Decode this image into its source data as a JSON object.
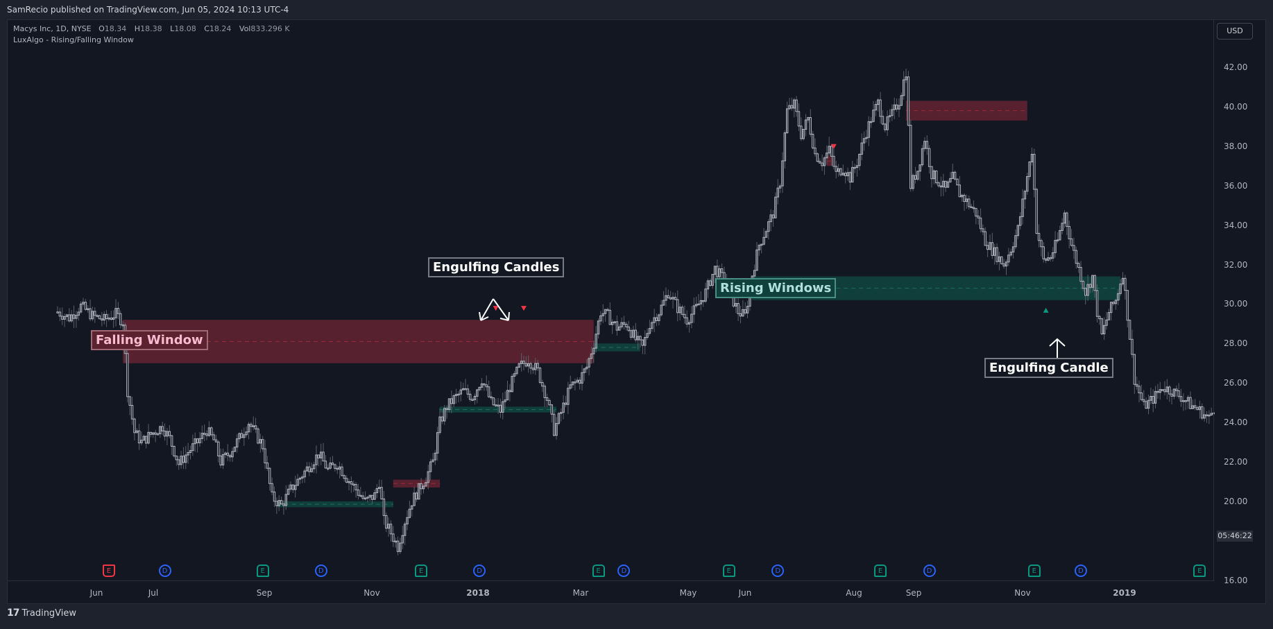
{
  "header": {
    "published": "SamRecio published on TradingView.com, Jun 05, 2024 10:13 UTC-4"
  },
  "legend": {
    "symbol": "Macys Inc, 1D, NYSE",
    "open_label": "O",
    "open": "18.34",
    "high_label": "H",
    "high": "18.38",
    "low_label": "L",
    "low": "18.08",
    "close_label": "C",
    "close": "18.24",
    "vol_label": "Vol",
    "vol": "833.296 K",
    "indicator": "LuxAlgo - Rising/Falling Window"
  },
  "currency": "USD",
  "countdown": "05:46:22",
  "footer": {
    "brand": "TradingView",
    "logo": "17"
  },
  "annotations": {
    "falling": "Falling Window",
    "rising": "Rising Windows",
    "engulfing_plural": "Engulfing Candles",
    "engulfing_single": "Engulfing Candle"
  },
  "colors": {
    "bg": "#131722",
    "candle": "#b2b5be",
    "bear_window": "#5c2230",
    "bull_window": "#10403c",
    "red": "#f23645",
    "green": "#089981",
    "blue": "#2962ff"
  },
  "chart_data": {
    "type": "candlestick",
    "title": "Macys Inc, 1D, NYSE",
    "ylim": [
      15.6,
      42.9
    ],
    "y_ticks": [
      "42.00",
      "40.00",
      "38.00",
      "36.00",
      "34.00",
      "32.00",
      "30.00",
      "28.00",
      "26.00",
      "24.00",
      "22.00",
      "20.00",
      "16.00"
    ],
    "x_ticks": [
      "Jun",
      "Jul",
      "Sep",
      "Nov",
      "2018",
      "Mar",
      "May",
      "Jun",
      "Aug",
      "Sep",
      "Nov",
      "2019"
    ],
    "price_path": [
      [
        0,
        29.6
      ],
      [
        5,
        29.3
      ],
      [
        10,
        29.9
      ],
      [
        15,
        29.4
      ],
      [
        20,
        29.2
      ],
      [
        25,
        29.5
      ],
      [
        28,
        29.1
      ],
      [
        30,
        25.6
      ],
      [
        33,
        23.5
      ],
      [
        36,
        23.0
      ],
      [
        40,
        23.4
      ],
      [
        45,
        23.8
      ],
      [
        48,
        23.2
      ],
      [
        52,
        21.9
      ],
      [
        56,
        22.5
      ],
      [
        60,
        23.0
      ],
      [
        64,
        23.6
      ],
      [
        67,
        23.1
      ],
      [
        70,
        22.0
      ],
      [
        74,
        22.5
      ],
      [
        78,
        23.2
      ],
      [
        82,
        24.0
      ],
      [
        85,
        23.4
      ],
      [
        88,
        22.8
      ],
      [
        92,
        20.2
      ],
      [
        96,
        19.8
      ],
      [
        100,
        20.6
      ],
      [
        104,
        21.2
      ],
      [
        108,
        21.8
      ],
      [
        112,
        22.4
      ],
      [
        116,
        21.6
      ],
      [
        120,
        21.9
      ],
      [
        124,
        21.2
      ],
      [
        128,
        20.6
      ],
      [
        132,
        20.0
      ],
      [
        136,
        20.3
      ],
      [
        138,
        21.0
      ],
      [
        140,
        19.0
      ],
      [
        143,
        18.4
      ],
      [
        146,
        17.7
      ],
      [
        149,
        19.0
      ],
      [
        152,
        20.0
      ],
      [
        155,
        20.6
      ],
      [
        158,
        21.2
      ],
      [
        161,
        22.0
      ],
      [
        164,
        24.0
      ],
      [
        167,
        24.8
      ],
      [
        170,
        25.2
      ],
      [
        174,
        25.6
      ],
      [
        178,
        25.3
      ],
      [
        182,
        26.2
      ],
      [
        186,
        25.0
      ],
      [
        190,
        24.6
      ],
      [
        194,
        25.8
      ],
      [
        198,
        26.8
      ],
      [
        202,
        27.2
      ],
      [
        206,
        26.6
      ],
      [
        210,
        25.2
      ],
      [
        213,
        23.6
      ],
      [
        216,
        24.5
      ],
      [
        220,
        25.8
      ],
      [
        224,
        26.2
      ],
      [
        227,
        26.8
      ],
      [
        230,
        28.0
      ],
      [
        233,
        29.6
      ],
      [
        236,
        29.4
      ],
      [
        240,
        28.8
      ],
      [
        244,
        29.0
      ],
      [
        248,
        28.2
      ],
      [
        251,
        27.8
      ],
      [
        254,
        29.0
      ],
      [
        258,
        29.6
      ],
      [
        262,
        30.6
      ],
      [
        266,
        29.8
      ],
      [
        270,
        29.2
      ],
      [
        274,
        29.8
      ],
      [
        278,
        30.6
      ],
      [
        282,
        31.8
      ],
      [
        286,
        31.2
      ],
      [
        289,
        30.4
      ],
      [
        292,
        29.6
      ],
      [
        295,
        29.4
      ],
      [
        298,
        31.5
      ],
      [
        301,
        33.0
      ],
      [
        304,
        33.8
      ],
      [
        307,
        34.6
      ],
      [
        310,
        36.2
      ],
      [
        313,
        39.8
      ],
      [
        316,
        40.1
      ],
      [
        319,
        38.6
      ],
      [
        322,
        39.4
      ],
      [
        325,
        37.6
      ],
      [
        328,
        37.2
      ],
      [
        331,
        37.8
      ],
      [
        334,
        36.6
      ],
      [
        337,
        36.9
      ],
      [
        340,
        36.4
      ],
      [
        343,
        37.2
      ],
      [
        346,
        38.4
      ],
      [
        349,
        39.4
      ],
      [
        352,
        40.2
      ],
      [
        355,
        39.0
      ],
      [
        358,
        39.6
      ],
      [
        361,
        40.3
      ],
      [
        364,
        41.8
      ],
      [
        366,
        36.0
      ],
      [
        369,
        36.8
      ],
      [
        372,
        38.4
      ],
      [
        375,
        36.6
      ],
      [
        378,
        36.2
      ],
      [
        381,
        35.8
      ],
      [
        384,
        36.4
      ],
      [
        387,
        35.6
      ],
      [
        390,
        35.2
      ],
      [
        394,
        34.6
      ],
      [
        398,
        33.2
      ],
      [
        402,
        32.6
      ],
      [
        406,
        32.0
      ],
      [
        409,
        32.8
      ],
      [
        412,
        33.8
      ],
      [
        415,
        35.8
      ],
      [
        418,
        37.8
      ],
      [
        420,
        33.8
      ],
      [
        423,
        32.2
      ],
      [
        426,
        32.4
      ],
      [
        429,
        33.2
      ],
      [
        432,
        34.6
      ],
      [
        435,
        33.0
      ],
      [
        438,
        31.8
      ],
      [
        441,
        30.6
      ],
      [
        444,
        31.4
      ],
      [
        446,
        29.6
      ],
      [
        448,
        28.4
      ],
      [
        451,
        29.6
      ],
      [
        454,
        30.2
      ],
      [
        457,
        31.6
      ],
      [
        462,
        26.2
      ],
      [
        466,
        24.8
      ],
      [
        470,
        25.2
      ],
      [
        474,
        25.8
      ],
      [
        478,
        25.6
      ],
      [
        482,
        25.3
      ],
      [
        486,
        24.9
      ],
      [
        490,
        24.6
      ],
      [
        494,
        24.2
      ],
      [
        497,
        25.0
      ]
    ],
    "windows": [
      {
        "kind": "falling",
        "top": 29.2,
        "bottom": 27.0,
        "from": 28,
        "to": 230
      },
      {
        "kind": "rising",
        "top": 28.0,
        "bottom": 27.6,
        "from": 230,
        "to": 250
      },
      {
        "kind": "rising",
        "top": 24.8,
        "bottom": 24.5,
        "from": 164,
        "to": 214
      },
      {
        "kind": "rising",
        "top": 20.0,
        "bottom": 19.7,
        "from": 94,
        "to": 144
      },
      {
        "kind": "falling",
        "top": 21.1,
        "bottom": 20.7,
        "from": 144,
        "to": 164
      },
      {
        "kind": "rising",
        "top": 31.4,
        "bottom": 30.2,
        "from": 298,
        "to": 456
      },
      {
        "kind": "falling",
        "top": 40.3,
        "bottom": 39.3,
        "from": 364,
        "to": 416
      },
      {
        "kind": "falling",
        "top": 37.5,
        "bottom": 37.0,
        "from": 330,
        "to": 333
      }
    ],
    "signals": [
      {
        "kind": "bear",
        "bar": 188,
        "price": 29.8
      },
      {
        "kind": "bear",
        "bar": 200,
        "price": 29.8
      },
      {
        "kind": "bear",
        "bar": 333,
        "price": 38.0
      },
      {
        "kind": "bull",
        "bar": 424,
        "price": 29.7
      }
    ],
    "events": [
      {
        "kind": "er",
        "label": "E",
        "bar": 22
      },
      {
        "kind": "d",
        "label": "D",
        "bar": 46
      },
      {
        "kind": "e",
        "label": "E",
        "bar": 88
      },
      {
        "kind": "d",
        "label": "D",
        "bar": 113
      },
      {
        "kind": "e",
        "label": "E",
        "bar": 156
      },
      {
        "kind": "d",
        "label": "D",
        "bar": 181
      },
      {
        "kind": "e",
        "label": "E",
        "bar": 232
      },
      {
        "kind": "d",
        "label": "D",
        "bar": 243
      },
      {
        "kind": "e",
        "label": "E",
        "bar": 288
      },
      {
        "kind": "d",
        "label": "D",
        "bar": 309
      },
      {
        "kind": "e",
        "label": "E",
        "bar": 353
      },
      {
        "kind": "d",
        "label": "D",
        "bar": 374
      },
      {
        "kind": "e",
        "label": "E",
        "bar": 419
      },
      {
        "kind": "d",
        "label": "D",
        "bar": 439
      },
      {
        "kind": "e",
        "label": "E",
        "bar": 490
      }
    ]
  }
}
